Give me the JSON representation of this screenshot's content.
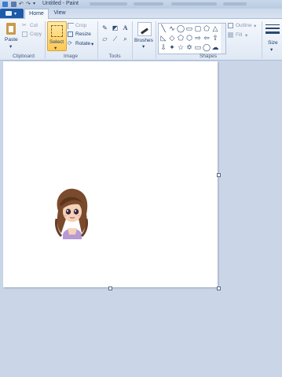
{
  "window": {
    "title": "Untitled - Paint"
  },
  "tabs": [
    {
      "label": "Home",
      "active": true
    },
    {
      "label": "View",
      "active": false
    }
  ],
  "clipboard": {
    "paste": "Paste",
    "cut": "Cut",
    "copy": "Copy",
    "group": "Clipboard"
  },
  "image": {
    "select": "Select",
    "crop": "Crop",
    "resize": "Resize",
    "rotate": "Rotate",
    "group": "Image"
  },
  "tools": {
    "group": "Tools",
    "items": [
      "pencil-icon",
      "fill-icon",
      "text-icon",
      "eraser-icon",
      "color-picker-icon",
      "magnifier-icon"
    ]
  },
  "brushes": {
    "label": "Brushes"
  },
  "shapes": {
    "outline": "Outline",
    "fill": "Fill",
    "group": "Shapes"
  },
  "size": {
    "label": "Size"
  },
  "canvas": {
    "content": "avatar-girl-image"
  },
  "colors": {
    "accent": "#ffc94f",
    "canvas_bg": "#ffffff",
    "workspace": "#cad6e8"
  }
}
